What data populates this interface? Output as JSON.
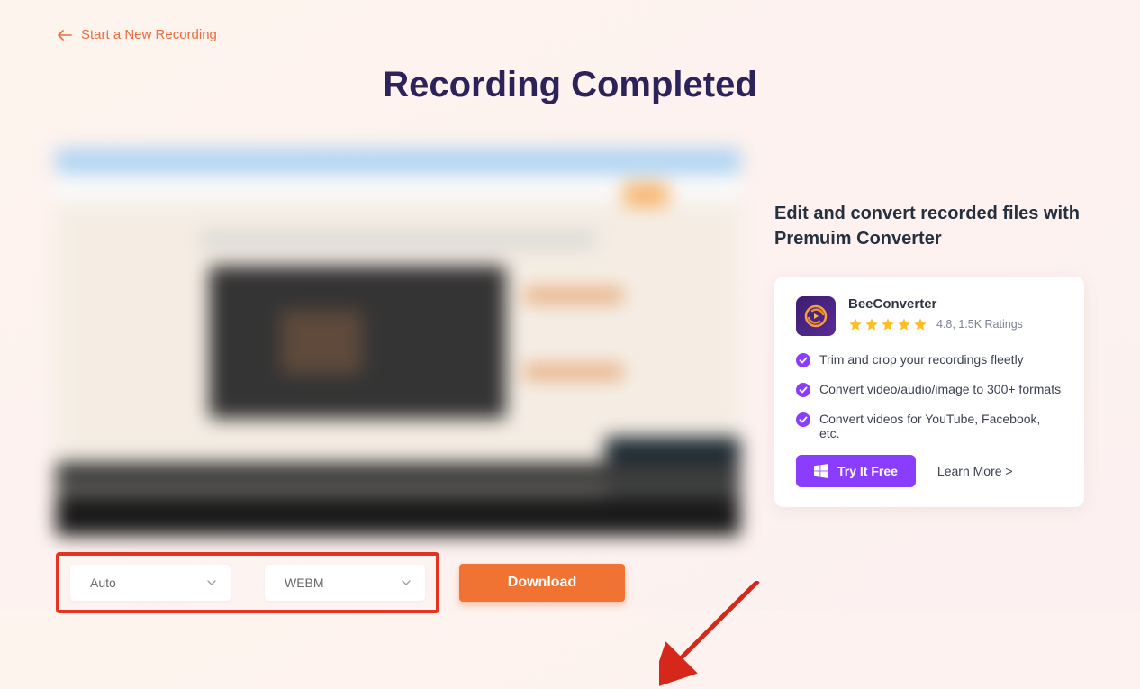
{
  "nav": {
    "back_label": "Start a New Recording"
  },
  "page": {
    "title": "Recording Completed"
  },
  "controls": {
    "quality_select": "Auto",
    "format_select": "WEBM",
    "download_label": "Download"
  },
  "promo": {
    "heading": "Edit and convert recorded files with Premuim Converter",
    "app_name": "BeeConverter",
    "rating_text": "4.8, 1.5K Ratings",
    "features": [
      "Trim and crop your recordings fleetly",
      "Convert video/audio/image to 300+ formats",
      "Convert videos for YouTube, Facebook, etc."
    ],
    "try_label": "Try It Free",
    "learn_label": "Learn More >"
  }
}
